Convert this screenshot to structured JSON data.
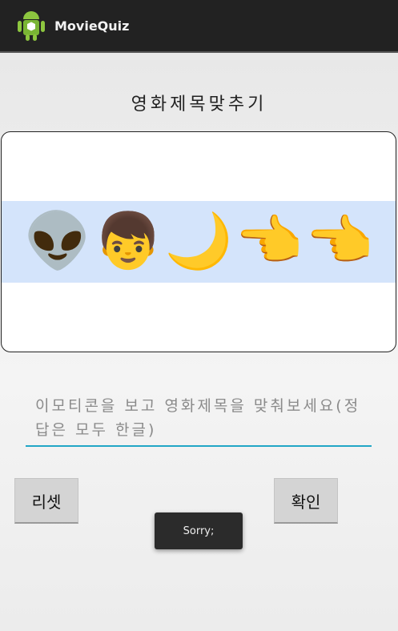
{
  "app": {
    "title": "MovieQuiz",
    "icon": "android-icon",
    "brand_color": "#8dc63f"
  },
  "main": {
    "heading": "영화제목맞추기",
    "emoji_clue": [
      {
        "icon": "alien-icon",
        "glyph": "👽"
      },
      {
        "icon": "boy-icon",
        "glyph": "👦"
      },
      {
        "icon": "crescent-moon-icon",
        "glyph": "🌙"
      },
      {
        "icon": "pointing-left-hand-icon",
        "glyph": "👈"
      },
      {
        "icon": "pointing-left-hand-icon",
        "glyph": "👈"
      }
    ],
    "answer_input": {
      "value": "",
      "placeholder": "이모티콘을 보고 영화제목을 맞춰보세요(정답은 모두 한글)"
    },
    "reset_label": "리셋",
    "confirm_label": "확인",
    "toast": "Sorry;"
  },
  "colors": {
    "action_bar": "#222222",
    "input_underline": "#22a6c6",
    "emoji_highlight": "#d4e4fb"
  }
}
